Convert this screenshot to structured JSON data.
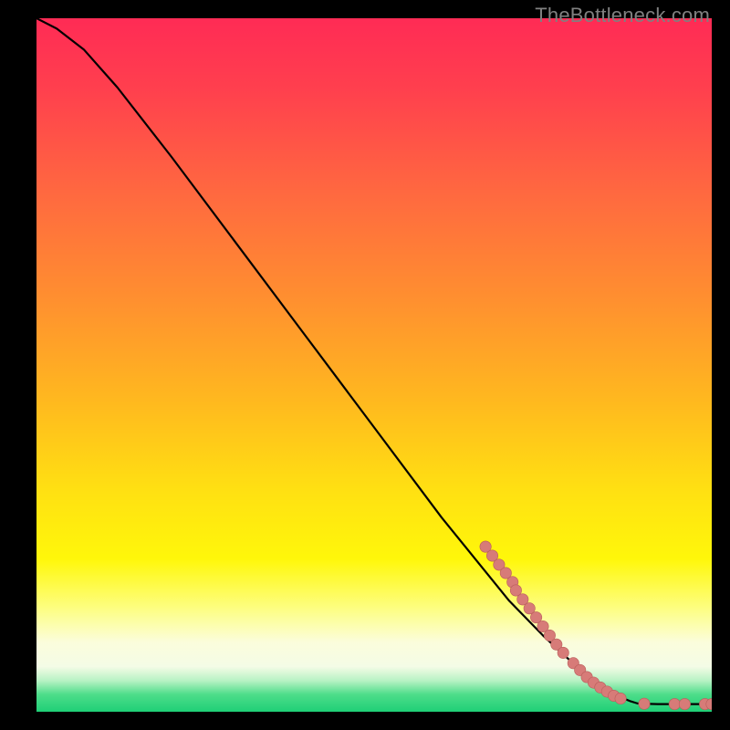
{
  "watermark": "TheBottleneck.com",
  "colors": {
    "gradient_stops": [
      {
        "offset": 0.0,
        "color": "#ff2b55"
      },
      {
        "offset": 0.1,
        "color": "#ff3f4e"
      },
      {
        "offset": 0.25,
        "color": "#ff6840"
      },
      {
        "offset": 0.4,
        "color": "#ff8e30"
      },
      {
        "offset": 0.55,
        "color": "#ffb81f"
      },
      {
        "offset": 0.68,
        "color": "#ffe012"
      },
      {
        "offset": 0.78,
        "color": "#fff70a"
      },
      {
        "offset": 0.85,
        "color": "#fdfe80"
      },
      {
        "offset": 0.9,
        "color": "#fbfddc"
      },
      {
        "offset": 0.935,
        "color": "#f4fce6"
      },
      {
        "offset": 0.955,
        "color": "#b8f2c4"
      },
      {
        "offset": 0.975,
        "color": "#4ddd8a"
      },
      {
        "offset": 1.0,
        "color": "#1fcf77"
      }
    ],
    "curve": "#000000",
    "marker_fill": "#d77b78",
    "marker_stroke": "#b95d5b",
    "frame": "#000000"
  },
  "chart_data": {
    "type": "line",
    "title": "",
    "xlabel": "",
    "ylabel": "",
    "xlim": [
      0,
      100
    ],
    "ylim": [
      0,
      100
    ],
    "curve": [
      {
        "x": 0,
        "y": 100
      },
      {
        "x": 3,
        "y": 98.5
      },
      {
        "x": 7,
        "y": 95.5
      },
      {
        "x": 12,
        "y": 90
      },
      {
        "x": 20,
        "y": 80
      },
      {
        "x": 30,
        "y": 67
      },
      {
        "x": 40,
        "y": 54
      },
      {
        "x": 50,
        "y": 41
      },
      {
        "x": 60,
        "y": 28
      },
      {
        "x": 65,
        "y": 22
      },
      {
        "x": 70,
        "y": 16
      },
      {
        "x": 75,
        "y": 11
      },
      {
        "x": 80,
        "y": 6.5
      },
      {
        "x": 84,
        "y": 3.5
      },
      {
        "x": 86,
        "y": 2.3
      },
      {
        "x": 88,
        "y": 1.5
      },
      {
        "x": 89,
        "y": 1.2
      },
      {
        "x": 90,
        "y": 1.15
      },
      {
        "x": 92,
        "y": 1.1
      },
      {
        "x": 95,
        "y": 1.1
      },
      {
        "x": 98,
        "y": 1.1
      },
      {
        "x": 100,
        "y": 1.1
      }
    ],
    "markers": [
      {
        "x": 66.5,
        "y": 23.8
      },
      {
        "x": 67.5,
        "y": 22.5
      },
      {
        "x": 68.5,
        "y": 21.2
      },
      {
        "x": 69.5,
        "y": 20.0
      },
      {
        "x": 70.5,
        "y": 18.7
      },
      {
        "x": 71.0,
        "y": 17.5
      },
      {
        "x": 72.0,
        "y": 16.2
      },
      {
        "x": 73.0,
        "y": 14.9
      },
      {
        "x": 74.0,
        "y": 13.6
      },
      {
        "x": 75.0,
        "y": 12.3
      },
      {
        "x": 76.0,
        "y": 11.0
      },
      {
        "x": 77.0,
        "y": 9.7
      },
      {
        "x": 78.0,
        "y": 8.5
      },
      {
        "x": 79.5,
        "y": 7.0
      },
      {
        "x": 80.5,
        "y": 6.0
      },
      {
        "x": 81.5,
        "y": 5.0
      },
      {
        "x": 82.5,
        "y": 4.2
      },
      {
        "x": 83.5,
        "y": 3.5
      },
      {
        "x": 84.5,
        "y": 2.9
      },
      {
        "x": 85.5,
        "y": 2.3
      },
      {
        "x": 86.5,
        "y": 1.9
      },
      {
        "x": 90.0,
        "y": 1.15
      },
      {
        "x": 94.5,
        "y": 1.1
      },
      {
        "x": 96.0,
        "y": 1.1
      },
      {
        "x": 99.0,
        "y": 1.1
      },
      {
        "x": 100.0,
        "y": 1.1
      }
    ]
  }
}
